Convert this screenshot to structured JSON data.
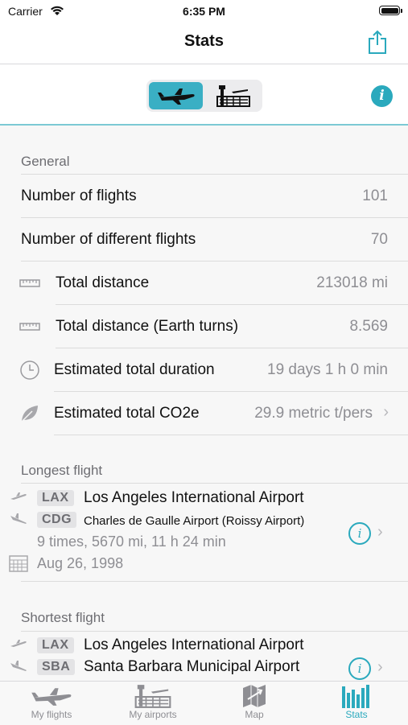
{
  "status_bar": {
    "carrier": "Carrier",
    "time": "6:35 PM"
  },
  "nav": {
    "title": "Stats"
  },
  "segmented": {
    "options": [
      "flights-icon",
      "airports-icon"
    ],
    "selected": 0
  },
  "colors": {
    "accent": "#2aa9bd",
    "selected_segment": "#3aafc4"
  },
  "general": {
    "header": "General",
    "rows": [
      {
        "label": "Number of flights",
        "value": "101"
      },
      {
        "label": "Number of different flights",
        "value": "70"
      },
      {
        "label": "Total distance",
        "value": "213018 mi",
        "icon": "ruler-icon"
      },
      {
        "label": "Total distance (Earth turns)",
        "value": "8.569",
        "icon": "ruler-icon"
      },
      {
        "label": "Estimated total duration",
        "value": "19 days 1 h 0 min",
        "icon": "clock-icon"
      },
      {
        "label": "Estimated total CO2e",
        "value": "29.9  metric t/pers",
        "icon": "leaf-icon"
      }
    ]
  },
  "longest": {
    "header": "Longest flight",
    "from_code": "LAX",
    "from_name": "Los Angeles International Airport",
    "to_code": "CDG",
    "to_name": "Charles de Gaulle Airport (Roissy Airport)",
    "summary": "9 times, 5670 mi, 11 h 24 min",
    "date": "Aug 26, 1998"
  },
  "shortest": {
    "header": "Shortest flight",
    "from_code": "LAX",
    "from_name": "Los Angeles International Airport",
    "to_code": "SBA",
    "to_name": "Santa Barbara Municipal Airport"
  },
  "tabs": [
    {
      "label": "My flights",
      "icon": "airplane-icon"
    },
    {
      "label": "My airports",
      "icon": "airport-icon"
    },
    {
      "label": "Map",
      "icon": "map-icon"
    },
    {
      "label": "Stats",
      "icon": "stats-icon",
      "active": true
    }
  ]
}
